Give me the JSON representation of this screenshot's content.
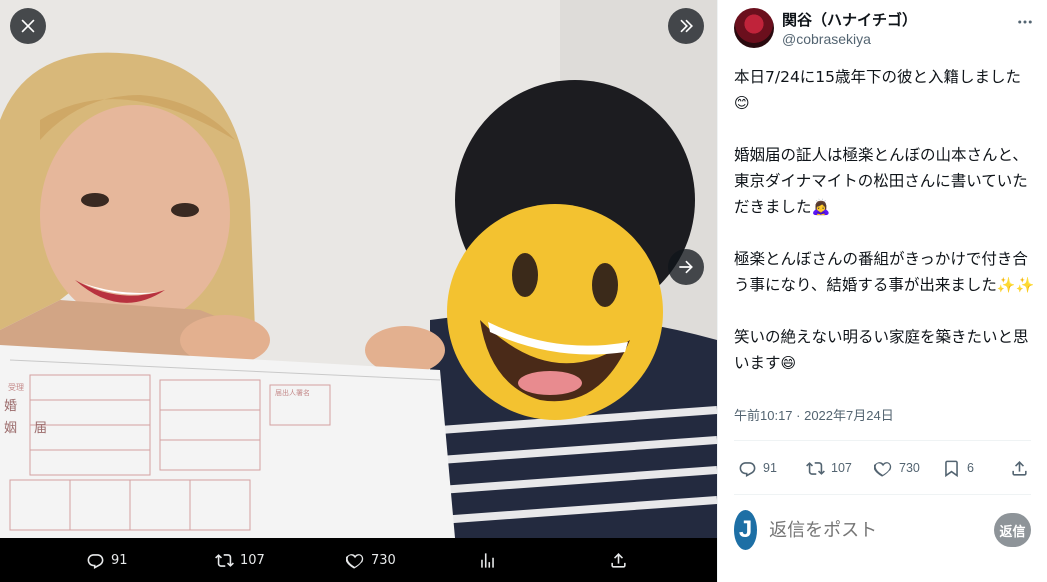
{
  "media": {
    "buttons": {
      "close": "close-icon",
      "expand": "double-chevron-right-icon",
      "next": "arrow-right-icon"
    },
    "bar": {
      "reply_count": "91",
      "repost_count": "107",
      "like_count": "730"
    },
    "document": {
      "title_char_1": "婚",
      "title_char_2": "姻",
      "title_char_3": "届",
      "stamp": "受理",
      "box_label": "届出人署名"
    }
  },
  "panel": {
    "display_name": "関谷（ハナイチゴ）",
    "handle": "@cobrasekiya",
    "paragraphs": [
      {
        "text": "本日7/24に15歳年下の彼と入籍しました",
        "emoji": "😊"
      },
      {
        "text": "婚姻届の証人は極楽とんぼの山本さんと、東京ダイナマイトの松田さんに書いていただきました",
        "emoji": "🙇‍♀️"
      },
      {
        "text": "極楽とんぼさんの番組がきっかけで付き合う事になり、結婚する事が出来ました",
        "emoji": "✨✨"
      },
      {
        "text": "笑いの絶えない明るい家庭を築きたいと思います",
        "emoji": "😄"
      }
    ],
    "timestamp": "午前10:17 · 2022年7月24日",
    "actions": {
      "reply_count": "91",
      "repost_count": "107",
      "like_count": "730",
      "bookmark_count": "6"
    },
    "reply": {
      "avatar_letter": "J",
      "placeholder": "返信をポスト",
      "button_label": "返信"
    }
  },
  "colors": {
    "panel_bg": "#ffffff",
    "text": "#0f1419",
    "muted": "#536471",
    "reply_button": "#8e9499",
    "reply_avatar": "#1d6fa5"
  }
}
